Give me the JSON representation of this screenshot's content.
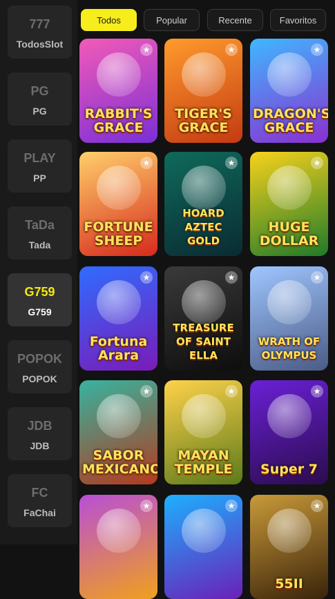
{
  "sidebar": {
    "providers": [
      {
        "name": "TodosSlot",
        "logo": "777",
        "active": false
      },
      {
        "name": "PG",
        "logo": "PG",
        "active": false
      },
      {
        "name": "PP",
        "logo": "PLAY",
        "active": false
      },
      {
        "name": "Tada",
        "logo": "TaDa",
        "active": false
      },
      {
        "name": "G759",
        "logo": "G759",
        "active": true
      },
      {
        "name": "POPOK",
        "logo": "POPOK",
        "active": false
      },
      {
        "name": "JDB",
        "logo": "JDB",
        "active": false
      },
      {
        "name": "FaChai",
        "logo": "FC",
        "active": false
      }
    ]
  },
  "tabs": [
    {
      "label": "Todos",
      "active": true
    },
    {
      "label": "Popular",
      "active": false
    },
    {
      "label": "Recente",
      "active": false
    },
    {
      "label": "Favoritos",
      "active": false
    }
  ],
  "games": [
    {
      "title": "RABBIT'S GRACE",
      "bg": [
        "#f25ab8",
        "#7b2fd6"
      ]
    },
    {
      "title": "TIGER'S GRACE",
      "bg": [
        "#ff9b2c",
        "#c43a12"
      ]
    },
    {
      "title": "DRAGON'S GRACE",
      "bg": [
        "#3fb7ff",
        "#8a2fd0"
      ]
    },
    {
      "title": "FORTUNE SHEEP",
      "bg": [
        "#ffcf6b",
        "#d62a1c"
      ]
    },
    {
      "title": "HOARD AZTEC GOLD",
      "bg": [
        "#0f6a5b",
        "#0a2b33"
      ]
    },
    {
      "title": "HUGE DOLLAR",
      "bg": [
        "#f7d21c",
        "#1f7a2a"
      ]
    },
    {
      "title": "Fortuna Arara",
      "bg": [
        "#2f6cff",
        "#7a1bb8"
      ]
    },
    {
      "title": "TREASURE OF SAINT ELLA",
      "bg": [
        "#3a3a3a",
        "#0d0d0d"
      ]
    },
    {
      "title": "WRATH OF OLYMPUS",
      "bg": [
        "#9fc6ff",
        "#4b5b86"
      ]
    },
    {
      "title": "SABOR MEXICANO",
      "bg": [
        "#37b3a0",
        "#b33a1e"
      ]
    },
    {
      "title": "MAYAN TEMPLE",
      "bg": [
        "#ffd24a",
        "#5c7a1a"
      ]
    },
    {
      "title": "Super 7",
      "bg": [
        "#6a20d6",
        "#2a0c4d"
      ]
    },
    {
      "title": "",
      "bg": [
        "#b84fd6",
        "#f0a01c"
      ]
    },
    {
      "title": "",
      "bg": [
        "#1db0ff",
        "#6a20b8"
      ]
    },
    {
      "title": "55II",
      "bg": [
        "#c99a3a",
        "#3a230a"
      ]
    }
  ],
  "colors": {
    "accent": "#f7ed1c",
    "background": "#121212",
    "sidebar": "#1a1a1a"
  },
  "icons": {
    "favorite": "star-icon"
  }
}
